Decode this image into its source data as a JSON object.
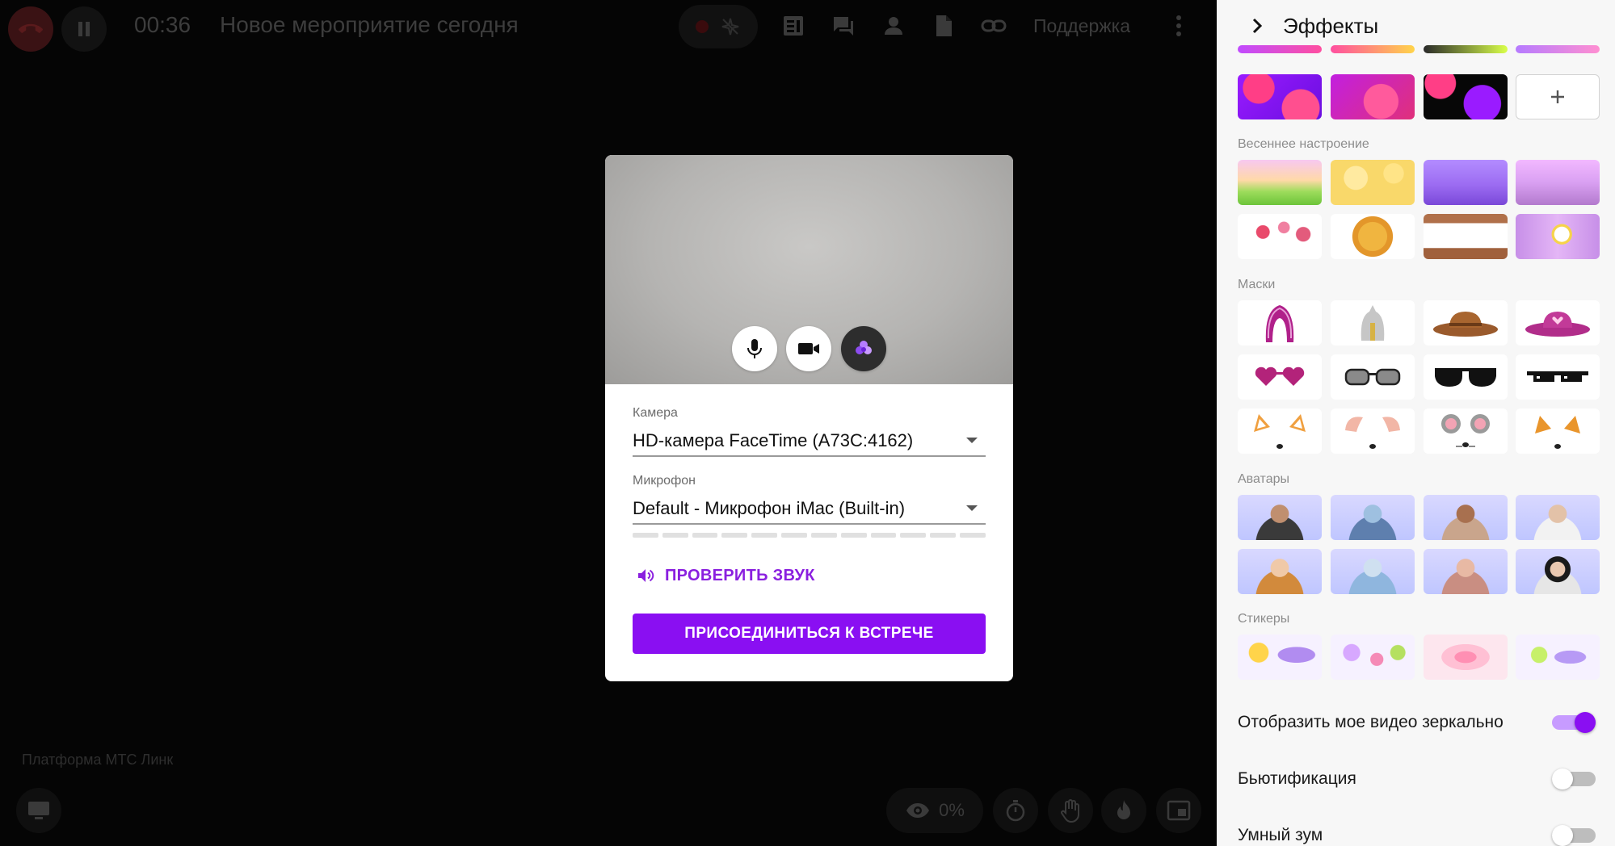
{
  "topbar": {
    "timer": "00:36",
    "title": "Новое мероприятие сегодня",
    "support": "Поддержка"
  },
  "join_dialog": {
    "camera_label": "Камера",
    "camera_value": "HD-камера FaceTime (A73C:4162)",
    "mic_label": "Микрофон",
    "mic_value": "Default - Микрофон iMac (Built-in)",
    "check_sound": "ПРОВЕРИТЬ ЗВУК",
    "join": "ПРИСОЕДИНИТЬСЯ К ВСТРЕЧЕ",
    "accent": "#8a0ff2"
  },
  "bottombar": {
    "platform": "Платформа МТС Линк",
    "viewers": "0%"
  },
  "effects": {
    "title": "Эффекты",
    "backgrounds": [
      "gradient-1",
      "gradient-2",
      "gradient-3"
    ],
    "add_icon": "plus-icon",
    "sections": [
      {
        "title": "Весеннее настроение",
        "items": [
          "spring-meadow",
          "spring-flowers",
          "spring-city",
          "spring-bridge",
          "flower-crown",
          "sunflower",
          "spring-window",
          "daisy-window"
        ]
      },
      {
        "title": "Маски",
        "items": [
          "kokoshnik",
          "helmet",
          "cowboy-hat",
          "pink-hat",
          "heart-glasses",
          "sunglasses-clear",
          "sunglasses-dark",
          "pixel-glasses",
          "fox-ears",
          "bunny-ears",
          "mouse-ears",
          "cat-ears"
        ]
      },
      {
        "title": "Аватары",
        "items": [
          "avatar-1",
          "avatar-2",
          "avatar-3",
          "avatar-4",
          "avatar-5",
          "avatar-6",
          "avatar-7",
          "avatar-8"
        ]
      },
      {
        "title": "Стикеры",
        "items": [
          "sticker-weather",
          "sticker-flowers",
          "sticker-hearts",
          "sticker-bunny"
        ]
      }
    ],
    "toggles": [
      {
        "label": "Отобразить мое видео зеркально",
        "on": true
      },
      {
        "label": "Бьютификация",
        "on": false
      },
      {
        "label": "Умный зум",
        "on": false
      }
    ]
  }
}
